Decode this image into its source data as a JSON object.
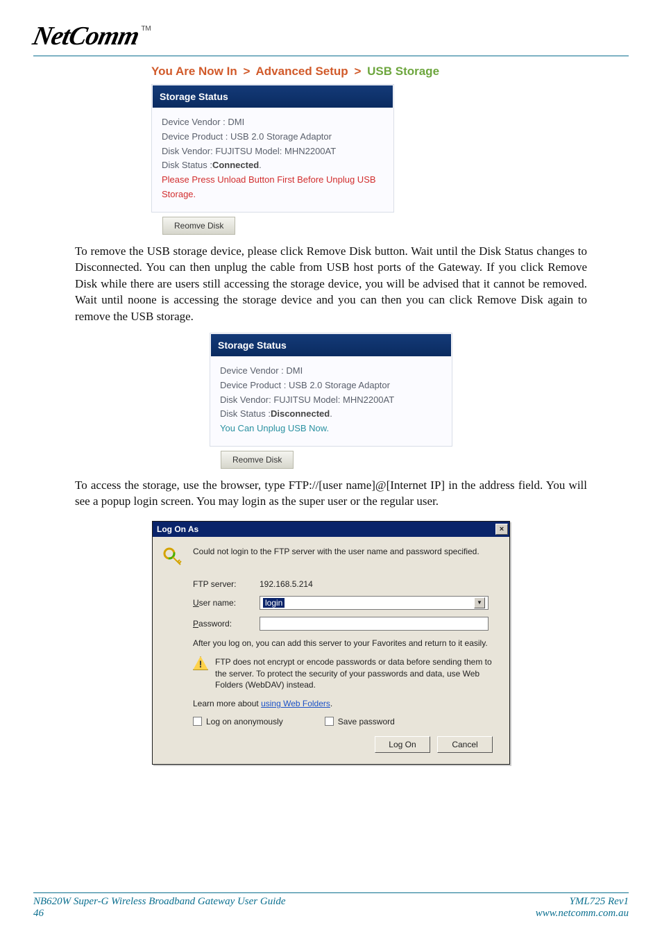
{
  "logo": {
    "text": "NetComm",
    "tm": "TM"
  },
  "breadcrumb": {
    "prefix": "You Are Now In",
    "sep": ">",
    "mid": "Advanced Setup",
    "current": "USB Storage"
  },
  "panel1": {
    "title": "Storage Status",
    "l1": "Device Vendor : DMI",
    "l2": "Device Product : USB 2.0 Storage Adaptor",
    "l3": "Disk   Vendor: FUJITSU Model: MHN2200AT",
    "l4a": "Disk   Status :",
    "l4b": "Connected",
    "l5": "Please Press Unload Button First Before Unplug USB Storage.",
    "btn": "Reomve Disk"
  },
  "para1": "To remove the USB storage device, please click Remove Disk button. Wait until the Disk Status changes to Disconnected.  You can then unplug the cable from USB host ports of the Gateway.  If you click Remove Disk while there are users still accessing the storage device, you will be advised that it cannot be removed.  Wait until noone is accessing the storage device and you can then you can click Remove Disk again to remove the USB storage.",
  "panel2": {
    "title": "Storage Status",
    "l1": "Device Vendor : DMI",
    "l2": "Device Product : USB 2.0 Storage Adaptor",
    "l3": "Disk   Vendor: FUJITSU Model: MHN2200AT",
    "l4a": "Disk   Status :",
    "l4b": "Disconnected",
    "l5": "You Can Unplug USB Now.",
    "btn": "Reomve Disk"
  },
  "para2": "To access the storage, use the browser, type FTP://[user name]@[Internet IP] in the address field. You will see a popup login screen. You may login as the super user or the regular user.",
  "dialog": {
    "title": "Log On As",
    "msg": "Could not login to the FTP server with the user name and password specified.",
    "ftp_label": "FTP server:",
    "ftp_value": "192.168.5.214",
    "user_label": "User name:",
    "user_value": "login",
    "pass_label": "Password:",
    "favnote": "After you log on, you can add this server to your Favorites and return to it easily.",
    "warn": "FTP does not encrypt or encode passwords or data before sending them to the server.  To protect the security of your passwords and data, use Web Folders (WebDAV) instead.",
    "learn_prefix": "Learn more about ",
    "learn_link": "using Web Folders",
    "chk_anon": "Log on anonymously",
    "chk_save": "Save password",
    "btn_logon": "Log On",
    "btn_cancel": "Cancel"
  },
  "footer": {
    "guide": "NB620W Super-G Wireless Broadband  Gateway User Guide",
    "page": "46",
    "rev": "YML725 Rev1",
    "url": "www.netcomm.com.au"
  }
}
